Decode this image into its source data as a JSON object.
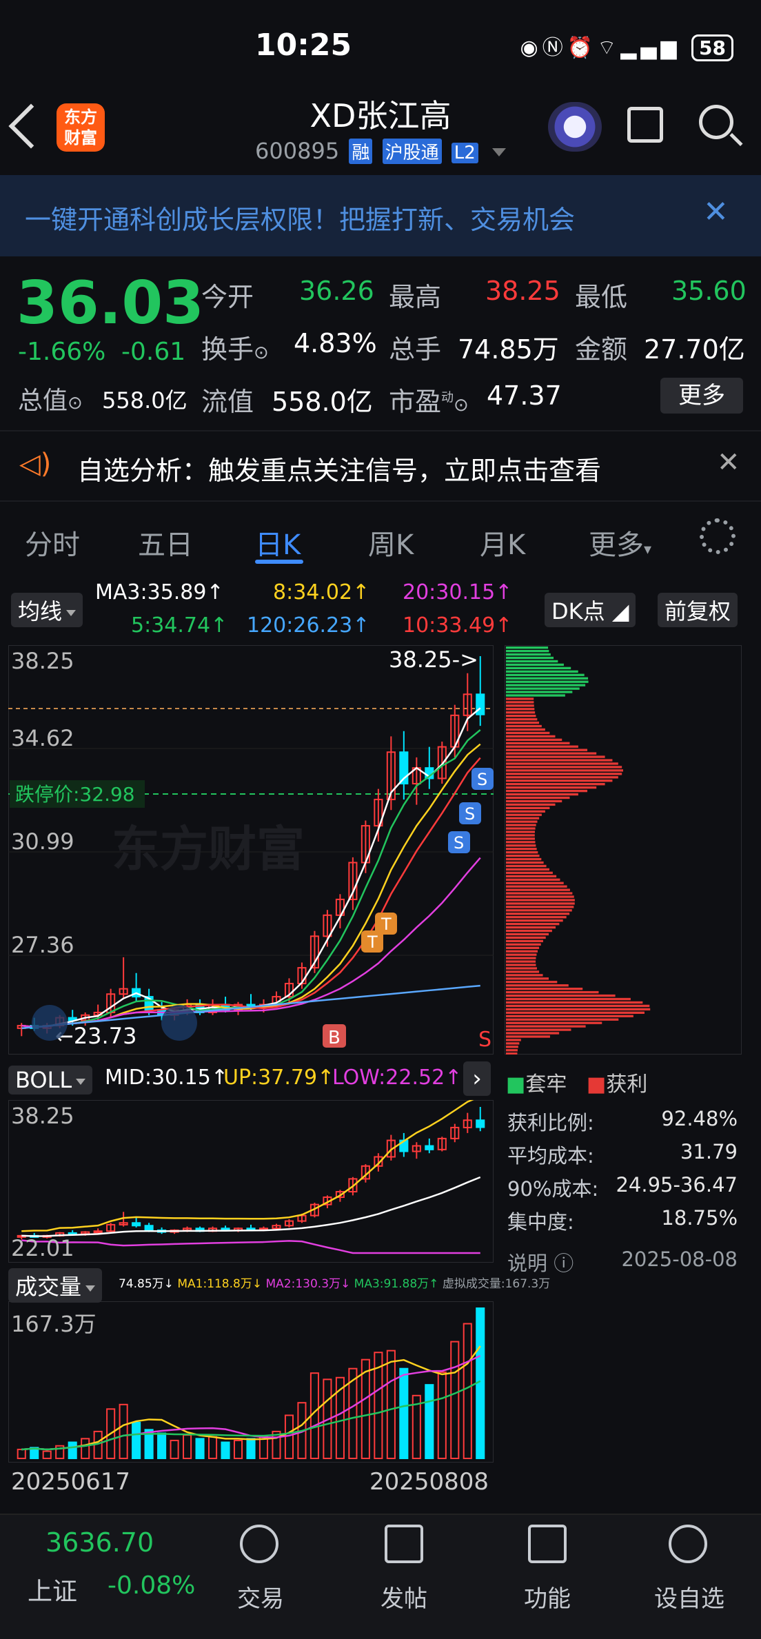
{
  "status": {
    "time": "10:25",
    "battery": "58"
  },
  "header": {
    "title": "XD张江高",
    "code": "600895",
    "tags": [
      "融",
      "沪股通",
      "L2"
    ],
    "logo": "东方\n财富"
  },
  "banner": {
    "text": "一键开通科创成长层权限！把握打新、交易机会"
  },
  "quote": {
    "price": "36.03",
    "change_pct": "-1.66%",
    "change": "-0.61",
    "open_label": "今开",
    "open": "36.26",
    "high_label": "最高",
    "high": "38.25",
    "low_label": "最低",
    "low": "35.60",
    "turnover_label": "换手",
    "turnover": "4.83%",
    "volume_label": "总手",
    "volume": "74.85万",
    "amount_label": "金额",
    "amount": "27.70亿",
    "mktcap_label": "总值",
    "mktcap": "558.0亿",
    "float_label": "流值",
    "float": "558.0亿",
    "pe_label": "市盈",
    "pe_sup": "动",
    "pe": "47.37",
    "more_label": "更多"
  },
  "alert": {
    "text": "自选分析：触发重点关注信号，立即点击查看"
  },
  "tabs": [
    {
      "label": "分时"
    },
    {
      "label": "五日"
    },
    {
      "label": "日K"
    },
    {
      "label": "周K"
    },
    {
      "label": "月K"
    },
    {
      "label": "更多"
    }
  ],
  "indicator": {
    "ma_label": "均线",
    "ma3": "MA3:35.89↑",
    "ma8": "8:34.02↑",
    "ma20": "20:30.15↑",
    "ma5": "5:34.74↑",
    "ma120": "120:26.23↑",
    "ma10": "10:33.49↑",
    "dk_label": "DK点",
    "adjust_label": "前复权"
  },
  "main_chart": {
    "y_labels": [
      "38.25",
      "34.62",
      "30.99",
      "27.36"
    ],
    "high_marker": "38.25->",
    "low_marker": "←23.73",
    "limit_down": "跌停价:32.98",
    "watermark": "东方财富",
    "markers": {
      "b": "B",
      "s": "S",
      "t": "T"
    }
  },
  "boll": {
    "label": "BOLL",
    "mid": "MID:30.15↑",
    "up": "UP:37.79↑",
    "low": "LOW:22.52↑",
    "y_top": "38.25",
    "y_bottom": "22.01"
  },
  "volume": {
    "label": "成交量",
    "stats": "74.85万↓",
    "ma1": "MA1:118.8万↓",
    "ma2": "MA2:130.3万↓",
    "ma3": "MA3:91.88万↑",
    "virtual": "虚拟成交量:167.3万",
    "y_top": "167.3万",
    "x_start": "20250617",
    "x_end": "20250808"
  },
  "chips": {
    "legend_trapped": "套牢",
    "legend_profit": "获利",
    "rows": [
      {
        "label": "获利比例:",
        "value": "92.48%"
      },
      {
        "label": "平均成本:",
        "value": "31.79"
      },
      {
        "label": "90%成本:",
        "value": "24.95-36.47"
      },
      {
        "label": "集中度:",
        "value": "18.75%"
      }
    ],
    "note_label": "说明",
    "date": "2025-08-08"
  },
  "bottom": {
    "index_value": "3636.70",
    "index_name": "上证",
    "index_change": "-0.08%",
    "nav": [
      {
        "label": "交易"
      },
      {
        "label": "发帖"
      },
      {
        "label": "功能"
      },
      {
        "label": "设自选"
      }
    ]
  },
  "chart_data": {
    "type": "candlestick",
    "y_range": [
      23.73,
      38.25
    ],
    "candles": [
      [
        24.1,
        24.3,
        23.8,
        24.2
      ],
      [
        24.2,
        24.5,
        24.0,
        24.1
      ],
      [
        24.1,
        24.3,
        23.9,
        24.2
      ],
      [
        24.2,
        24.6,
        24.1,
        24.5
      ],
      [
        24.5,
        24.8,
        24.2,
        24.4
      ],
      [
        24.4,
        24.7,
        24.2,
        24.6
      ],
      [
        24.6,
        25.0,
        24.4,
        24.7
      ],
      [
        24.7,
        25.6,
        24.5,
        25.4
      ],
      [
        25.4,
        26.8,
        25.2,
        25.6
      ],
      [
        25.6,
        26.2,
        25.1,
        25.3
      ],
      [
        25.3,
        25.6,
        24.6,
        24.8
      ],
      [
        24.8,
        25.1,
        24.4,
        24.6
      ],
      [
        24.6,
        24.9,
        24.4,
        24.8
      ],
      [
        24.8,
        25.2,
        24.6,
        25.0
      ],
      [
        25.0,
        25.2,
        24.6,
        24.7
      ],
      [
        24.7,
        25.2,
        24.6,
        25.0
      ],
      [
        25.0,
        25.3,
        24.7,
        24.8
      ],
      [
        24.8,
        25.1,
        24.6,
        25.0
      ],
      [
        25.0,
        25.4,
        24.8,
        24.9
      ],
      [
        24.9,
        25.2,
        24.7,
        25.0
      ],
      [
        25.0,
        25.5,
        24.9,
        25.3
      ],
      [
        25.3,
        26.0,
        25.1,
        25.8
      ],
      [
        25.8,
        26.6,
        25.6,
        26.4
      ],
      [
        26.4,
        27.8,
        26.2,
        27.6
      ],
      [
        27.6,
        28.6,
        27.2,
        28.4
      ],
      [
        28.4,
        29.2,
        27.9,
        29.0
      ],
      [
        29.0,
        30.6,
        28.6,
        30.4
      ],
      [
        30.4,
        32.0,
        30.0,
        31.8
      ],
      [
        31.8,
        33.2,
        31.2,
        32.8
      ],
      [
        32.8,
        35.2,
        32.4,
        34.6
      ],
      [
        34.6,
        35.4,
        32.8,
        33.4
      ],
      [
        33.4,
        34.4,
        32.6,
        34.0
      ],
      [
        34.0,
        34.8,
        33.2,
        33.6
      ],
      [
        33.6,
        35.0,
        33.4,
        34.8
      ],
      [
        34.8,
        36.4,
        34.4,
        36.0
      ],
      [
        36.0,
        37.6,
        35.4,
        36.8
      ],
      [
        36.8,
        38.25,
        35.6,
        36.03
      ]
    ],
    "volumes": [
      10,
      12,
      8,
      14,
      18,
      22,
      30,
      55,
      60,
      40,
      32,
      28,
      20,
      26,
      22,
      24,
      18,
      20,
      22,
      24,
      30,
      48,
      62,
      95,
      88,
      90,
      100,
      110,
      118,
      120,
      100,
      70,
      82,
      96,
      130,
      150,
      167.3
    ],
    "volume_y_range": [
      0,
      167.3
    ],
    "boll_y_range": [
      22.01,
      38.25
    ]
  }
}
